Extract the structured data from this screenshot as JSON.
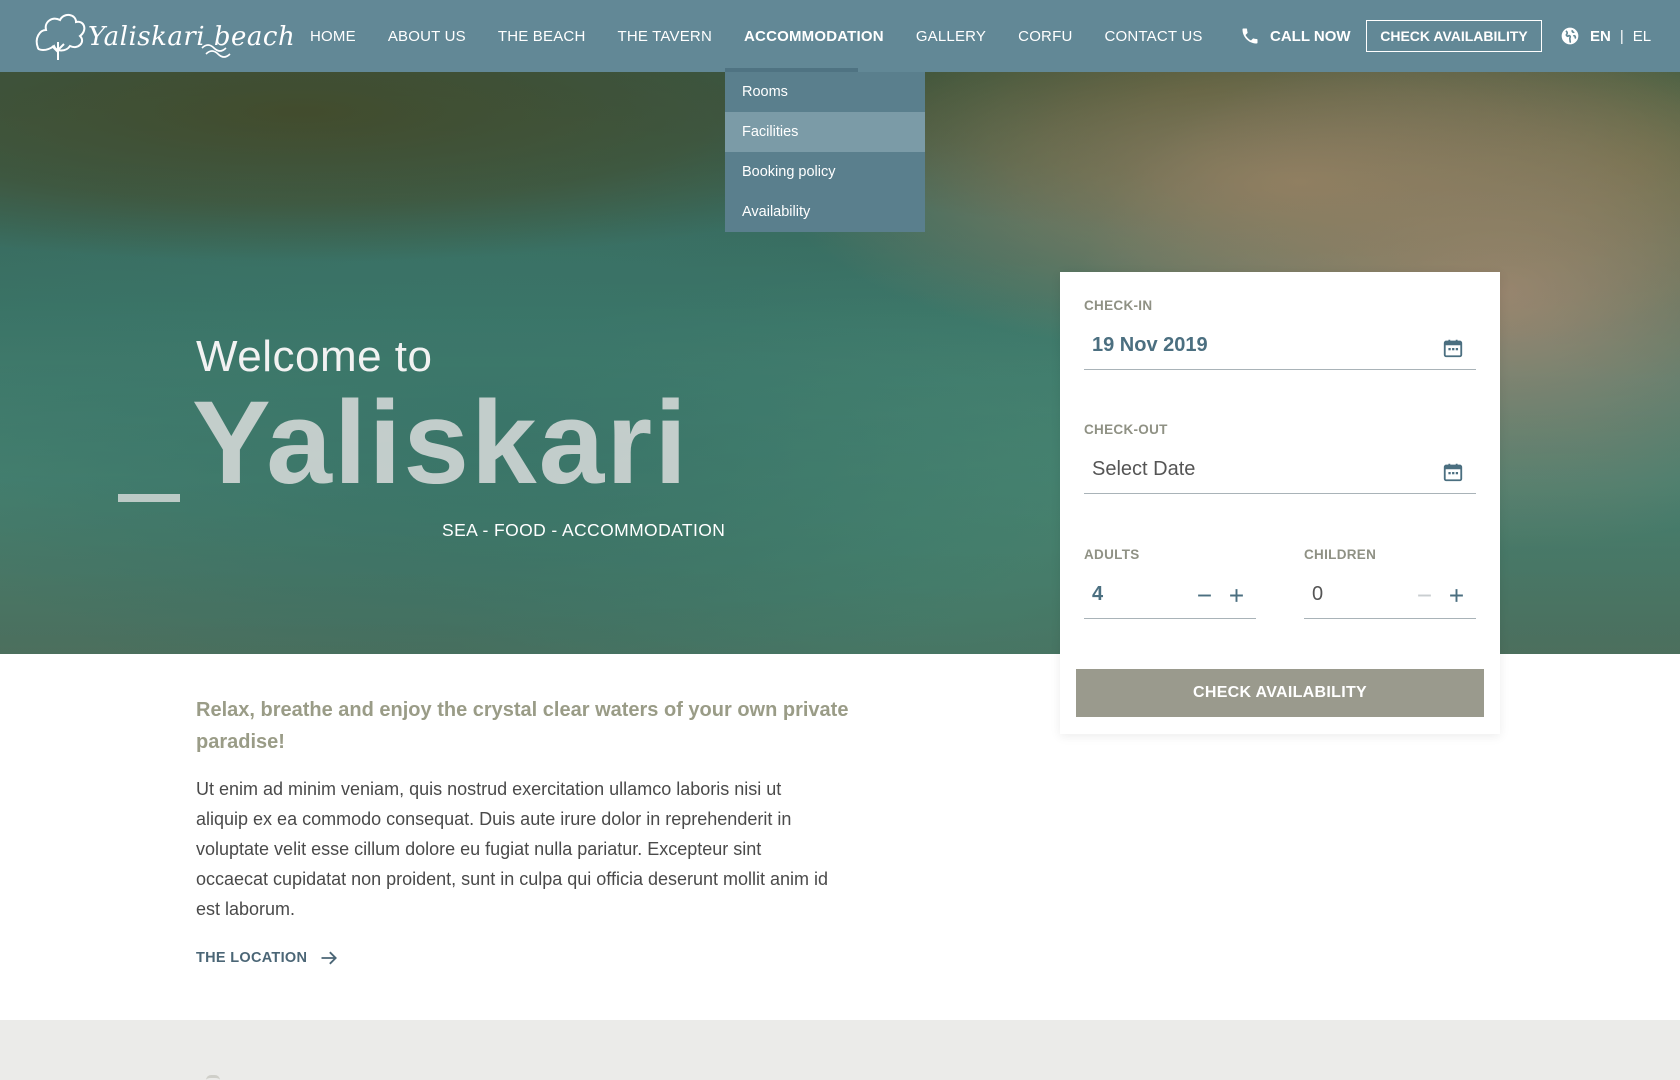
{
  "brand": {
    "logo_text": "Yaliskari beach"
  },
  "nav": {
    "items": [
      {
        "label": "HOME"
      },
      {
        "label": "ABOUT US"
      },
      {
        "label": "THE BEACH"
      },
      {
        "label": "THE TAVERN"
      },
      {
        "label": "ACCOMMODATION",
        "active": true
      },
      {
        "label": "GALLERY"
      },
      {
        "label": "CORFU"
      },
      {
        "label": "CONTACT US"
      }
    ]
  },
  "header": {
    "call_label": "CALL NOW",
    "check_availability_label": "CHECK AVAILABILITY",
    "lang_en": "EN",
    "lang_separator": "|",
    "lang_el": "EL"
  },
  "dropdown": {
    "items": [
      {
        "label": "Rooms"
      },
      {
        "label": "Facilities",
        "hover": true
      },
      {
        "label": "Booking policy"
      },
      {
        "label": "Availability"
      }
    ]
  },
  "hero": {
    "welcome": "Welcome to",
    "brand": "Yaliskari",
    "tagline": "SEA - FOOD - ACCOMMODATION"
  },
  "booking": {
    "checkin_label": "CHECK-IN",
    "checkin_value": "19 Nov 2019",
    "checkout_label": "CHECK-OUT",
    "checkout_placeholder": "Select Date",
    "adults_label": "ADULTS",
    "adults_value": "4",
    "children_label": "CHILDREN",
    "children_value": "0",
    "button_label": "CHECK AVAILABILITY"
  },
  "intro": {
    "headline": "Relax, breathe and enjoy the crystal clear waters of your own private paradise!",
    "body": "Ut enim ad minim veniam, quis nostrud exercitation ullamco laboris nisi ut aliquip ex ea commodo consequat. Duis aute irure dolor in reprehenderit in voluptate velit esse cillum dolore eu fugiat nulla pariatur. Excepteur sint occaecat cupidatat non proident, sunt in culpa qui officia deserunt mollit anim id est laborum.",
    "link_label": "THE LOCATION"
  },
  "colors": {
    "header_bg": "#628896",
    "dropdown_bg": "#5a7f8d",
    "accent_olive": "#9a9c87",
    "button_gray": "#9a9a8d",
    "value_blue": "#4b6f80"
  },
  "icons": [
    "logo-tree-icon",
    "phone-icon",
    "globe-icon",
    "calendar-icon",
    "minus-icon",
    "plus-icon",
    "arrow-right-icon"
  ]
}
